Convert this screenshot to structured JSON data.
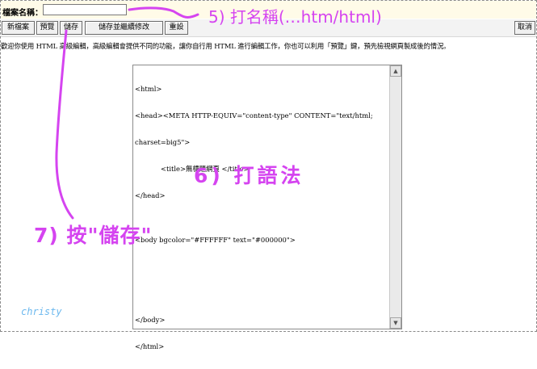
{
  "file_bar": {
    "label": "檔案名稱：",
    "filename_value": ""
  },
  "toolbar": {
    "new_file": "新檔案",
    "preview": "預覽",
    "save": "儲存",
    "save_continue": "儲存並繼續修改",
    "reset": "重設",
    "cancel": "取消"
  },
  "intro_text": "歡迎你使用 HTML 高級編輯，高級編輯會提供不同的功能，讓你自行用 HTML 進行編輯工作，你也可以利用「預覽」鍵，預先檢視網頁製成後的情況。",
  "editor": {
    "code_lines": [
      "<html>",
      "<head><META HTTP-EQUIV=\"content-type\" CONTENT=\"text/html;",
      "charset=big5\">",
      "            <title>無標題網頁 </title>",
      "</head>",
      "",
      "<body bgcolor=\"#FFFFFF\" text=\"#000000\">",
      "",
      "",
      "",
      "</body>",
      "</html>"
    ]
  },
  "annotations": {
    "step5": "5) 打名稱(…htm/html)",
    "step6": "6) 打語法",
    "step7": "7) 按\"儲存\""
  },
  "watermark": "christy",
  "colors": {
    "annotation": "#d544f0",
    "watermark": "#6cb8ee",
    "file_bar_bg": "#fffbe8"
  }
}
